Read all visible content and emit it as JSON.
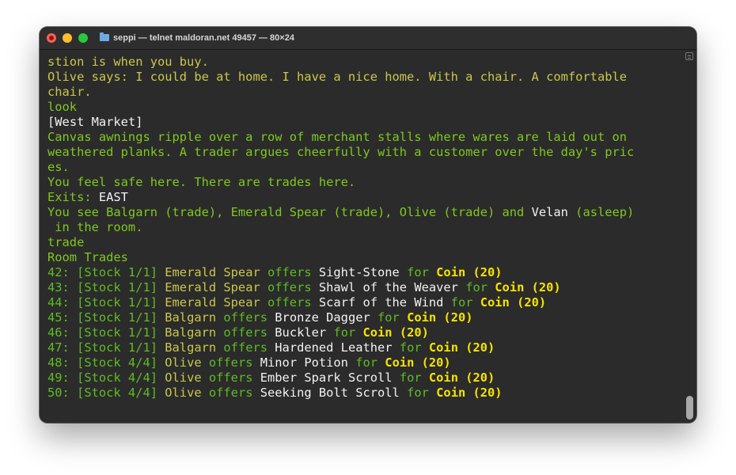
{
  "window": {
    "title": "seppi — telnet maldoran.net 49457 — 80×24",
    "icon": "folder-icon"
  },
  "colors": {
    "background": "#2b2b2b",
    "yellow_text": "#c8c84a",
    "green_text": "#7fc81e",
    "white_text": "#f2f2f2",
    "bold_yellow": "#f5e300"
  },
  "terminal": {
    "lines": [
      [
        {
          "t": "stion is when you buy.",
          "c": "y"
        }
      ],
      [
        {
          "t": "Olive says: I could be at home. I have a nice home. With a chair. A comfortable",
          "c": "y"
        }
      ],
      [
        {
          "t": "chair.",
          "c": "y"
        }
      ],
      [
        {
          "t": "look",
          "c": "g"
        }
      ],
      [
        {
          "t": "[",
          "c": "w"
        },
        {
          "t": "West Market",
          "c": "w"
        },
        {
          "t": "]",
          "c": "w"
        }
      ],
      [
        {
          "t": "Canvas awnings ripple over a row of merchant stalls where wares are laid out on",
          "c": "g"
        }
      ],
      [
        {
          "t": "weathered planks. A trader argues cheerfully with a customer over the day's pric",
          "c": "g"
        }
      ],
      [
        {
          "t": "es.",
          "c": "g"
        }
      ],
      [
        {
          "t": "You feel safe here. There are trades here.",
          "c": "g"
        }
      ],
      [
        {
          "t": "Exits: ",
          "c": "g"
        },
        {
          "t": "EAST",
          "c": "w"
        }
      ],
      [
        {
          "t": "You see Balgarn (trade), Emerald Spear (trade), Olive (trade) and ",
          "c": "g"
        },
        {
          "t": "Velan",
          "c": "w"
        },
        {
          "t": " (asleep)",
          "c": "g"
        }
      ],
      [
        {
          "t": " in the room.",
          "c": "g"
        }
      ],
      [
        {
          "t": "trade",
          "c": "g"
        }
      ],
      [
        {
          "t": "Room Trades",
          "c": "g"
        }
      ],
      [
        {
          "t": "42: [Stock 1/1] ",
          "c": "gd"
        },
        {
          "t": "Emerald Spear",
          "c": "y"
        },
        {
          "t": " offers ",
          "c": "gd"
        },
        {
          "t": "Sight-Stone",
          "c": "w"
        },
        {
          "t": " for ",
          "c": "gd"
        },
        {
          "t": "Coin (20)",
          "c": "yb"
        }
      ],
      [
        {
          "t": "43: [Stock 1/1] ",
          "c": "gd"
        },
        {
          "t": "Emerald Spear",
          "c": "y"
        },
        {
          "t": " offers ",
          "c": "gd"
        },
        {
          "t": "Shawl of the Weaver",
          "c": "w"
        },
        {
          "t": " for ",
          "c": "gd"
        },
        {
          "t": "Coin (20)",
          "c": "yb"
        }
      ],
      [
        {
          "t": "44: [Stock 1/1] ",
          "c": "gd"
        },
        {
          "t": "Emerald Spear",
          "c": "y"
        },
        {
          "t": " offers ",
          "c": "gd"
        },
        {
          "t": "Scarf of the Wind",
          "c": "w"
        },
        {
          "t": " for ",
          "c": "gd"
        },
        {
          "t": "Coin (20)",
          "c": "yb"
        }
      ],
      [
        {
          "t": "45: [Stock 1/1] ",
          "c": "gd"
        },
        {
          "t": "Balgarn",
          "c": "y"
        },
        {
          "t": " offers ",
          "c": "gd"
        },
        {
          "t": "Bronze Dagger",
          "c": "w"
        },
        {
          "t": " for ",
          "c": "gd"
        },
        {
          "t": "Coin (20)",
          "c": "yb"
        }
      ],
      [
        {
          "t": "46: [Stock 1/1] ",
          "c": "gd"
        },
        {
          "t": "Balgarn",
          "c": "y"
        },
        {
          "t": " offers ",
          "c": "gd"
        },
        {
          "t": "Buckler",
          "c": "w"
        },
        {
          "t": " for ",
          "c": "gd"
        },
        {
          "t": "Coin (20)",
          "c": "yb"
        }
      ],
      [
        {
          "t": "47: [Stock 1/1] ",
          "c": "gd"
        },
        {
          "t": "Balgarn",
          "c": "y"
        },
        {
          "t": " offers ",
          "c": "gd"
        },
        {
          "t": "Hardened Leather",
          "c": "w"
        },
        {
          "t": " for ",
          "c": "gd"
        },
        {
          "t": "Coin (20)",
          "c": "yb"
        }
      ],
      [
        {
          "t": "48: [Stock 4/4] ",
          "c": "gd"
        },
        {
          "t": "Olive",
          "c": "y"
        },
        {
          "t": " offers ",
          "c": "gd"
        },
        {
          "t": "Minor Potion",
          "c": "w"
        },
        {
          "t": " for ",
          "c": "gd"
        },
        {
          "t": "Coin (20)",
          "c": "yb"
        }
      ],
      [
        {
          "t": "49: [Stock 4/4] ",
          "c": "gd"
        },
        {
          "t": "Olive",
          "c": "y"
        },
        {
          "t": " offers ",
          "c": "gd"
        },
        {
          "t": "Ember Spark Scroll",
          "c": "w"
        },
        {
          "t": " for ",
          "c": "gd"
        },
        {
          "t": "Coin (20)",
          "c": "yb"
        }
      ],
      [
        {
          "t": "50: [Stock 4/4] ",
          "c": "gd"
        },
        {
          "t": "Olive",
          "c": "y"
        },
        {
          "t": " offers ",
          "c": "gd"
        },
        {
          "t": "Seeking Bolt Scroll",
          "c": "w"
        },
        {
          "t": " for ",
          "c": "gd"
        },
        {
          "t": "Coin (20)",
          "c": "yb"
        }
      ]
    ]
  }
}
